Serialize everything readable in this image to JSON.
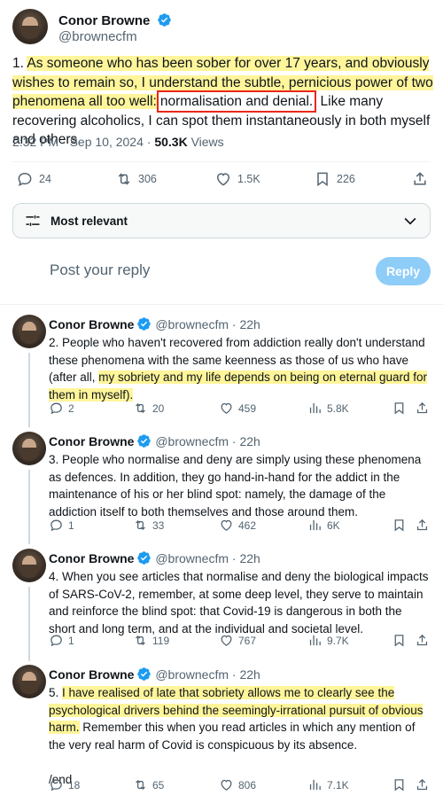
{
  "main": {
    "name": "Conor Browne",
    "handle": "@brownecfm",
    "text_prefix": "1. ",
    "text_hl1": "As someone who has been sober for over 17 years, and obviously",
    "text_mid1": " ",
    "text_hl2": "wishes to remain so, I understand the subtle, pernicious power of two phenomena all too well:",
    "text_boxed": "normalisation and denial.",
    "text_rest": " Like many recovering alcoholics, I can spot them instantaneously in both myself and others.",
    "time": "2:32 PM · Sep 10, 2024 · ",
    "views_count": "50.3K",
    "views_label": " Views",
    "stats": {
      "replies": "24",
      "reposts": "306",
      "likes": "1.5K",
      "bookmarks": "226"
    }
  },
  "sort": {
    "label": "Most relevant"
  },
  "reply_box": {
    "placeholder": "Post your reply",
    "button": "Reply"
  },
  "replies": [
    {
      "name": "Conor Browne",
      "handle": "@brownecfm",
      "time": "22h",
      "text": "2. People who haven't recovered from addiction really don't understand these phenomena with the same keenness as those of us who have (after all, ",
      "highlight": "my sobriety and my life depends on being on eternal guard for them in myself).",
      "text_after": "",
      "stats": {
        "replies": "2",
        "reposts": "20",
        "likes": "459",
        "views": "5.8K"
      }
    },
    {
      "name": "Conor Browne",
      "handle": "@brownecfm",
      "time": "22h",
      "text": "3. People who normalise and deny are simply using these phenomena as defences. In addition, they go hand-in-hand for the addict in the maintenance of his or her blind spot: namely, the damage of the addiction itself to both themselves and those around them.",
      "highlight": "",
      "text_after": "",
      "stats": {
        "replies": "1",
        "reposts": "33",
        "likes": "462",
        "views": "6K"
      }
    },
    {
      "name": "Conor Browne",
      "handle": "@brownecfm",
      "time": "22h",
      "text": "4. When you see articles that normalise and deny the biological impacts of SARS-CoV-2, remember, at some deep level, they serve to maintain and reinforce the blind spot: that Covid-19 is dangerous in both the short and long term, and at the individual and societal level.",
      "highlight": "",
      "text_after": "",
      "stats": {
        "replies": "1",
        "reposts": "119",
        "likes": "767",
        "views": "9.7K"
      }
    },
    {
      "name": "Conor Browne",
      "handle": "@brownecfm",
      "time": "22h",
      "text": "5. ",
      "highlight": "I have realised of late that sobriety allows me to clearly see the psychological drivers behind the seemingly-irrational pursuit of obvious harm.",
      "text_after": " Remember this when you read articles in which any mention of the very real harm of Covid is conspicuous by its absence.",
      "end": "/end",
      "stats": {
        "replies": "18",
        "reposts": "65",
        "likes": "806",
        "views": "7.1K"
      }
    }
  ],
  "colors": {
    "accent": "#1d9bf0",
    "highlight": "#fff59a",
    "box": "#e8281b",
    "reply_button": "#8ecdf8"
  }
}
